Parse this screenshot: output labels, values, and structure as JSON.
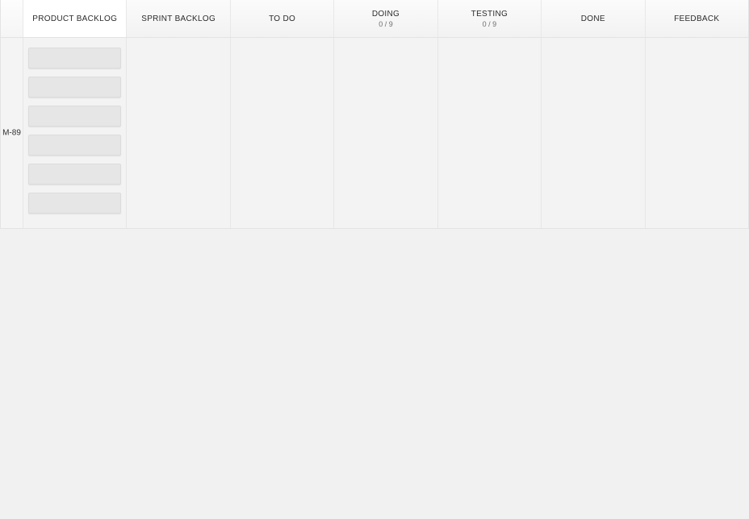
{
  "columns": [
    {
      "label": "PRODUCT BACKLOG",
      "sub": ""
    },
    {
      "label": "SPRINT BACKLOG",
      "sub": ""
    },
    {
      "label": "TO DO",
      "sub": ""
    },
    {
      "label": "DOING",
      "sub": "0 / 9"
    },
    {
      "label": "TESTING",
      "sub": "0 / 9"
    },
    {
      "label": "DONE",
      "sub": ""
    },
    {
      "label": "FEEDBACK",
      "sub": ""
    }
  ],
  "swimlane": {
    "label": "M-89",
    "card_count_col0": 6
  }
}
